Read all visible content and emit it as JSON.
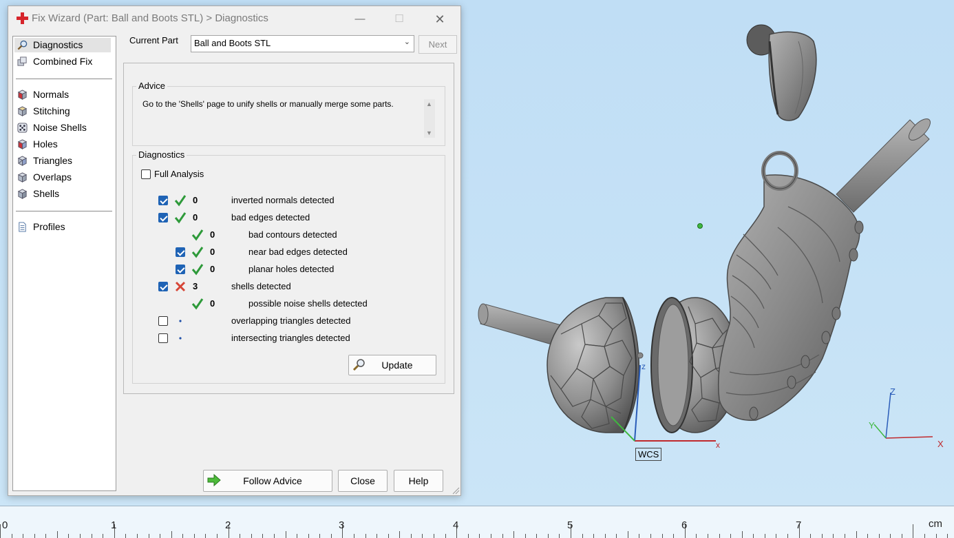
{
  "dialog": {
    "title": "Fix Wizard (Part: Ball and Boots STL) > Diagnostics",
    "window_controls": {
      "minimize": "—",
      "maximize": "☐",
      "close": "✕"
    }
  },
  "nav": {
    "items": [
      {
        "label": "Diagnostics",
        "icon": "magnifier-icon",
        "selected": true
      },
      {
        "label": "Combined Fix",
        "icon": "multi-cube-icon"
      },
      {
        "label": "Normals",
        "icon": "cube-red-face-icon"
      },
      {
        "label": "Stitching",
        "icon": "cube-stitch-icon"
      },
      {
        "label": "Noise Shells",
        "icon": "dice-icon"
      },
      {
        "label": "Holes",
        "icon": "cube-hole-icon"
      },
      {
        "label": "Triangles",
        "icon": "cube-triangle-icon"
      },
      {
        "label": "Overlaps",
        "icon": "cube-overlap-icon"
      },
      {
        "label": "Shells",
        "icon": "cube-shells-icon"
      },
      {
        "label": "Profiles",
        "icon": "document-icon"
      }
    ]
  },
  "header": {
    "current_part_label": "Current Part",
    "current_part_value": "Ball and Boots STL",
    "next_label": "Next"
  },
  "advice": {
    "title": "Advice",
    "text": "Go to the 'Shells' page to unify shells or manually merge some parts."
  },
  "diagnostics": {
    "title": "Diagnostics",
    "full_analysis_label": "Full Analysis",
    "full_analysis_checked": false,
    "rows": [
      {
        "checked": true,
        "status": "ok",
        "count": "0",
        "label": "inverted normals detected",
        "level": 0
      },
      {
        "checked": true,
        "status": "ok",
        "count": "0",
        "label": "bad edges detected",
        "level": 0
      },
      {
        "checked": null,
        "status": "ok",
        "count": "0",
        "label": "bad contours detected",
        "level": 1
      },
      {
        "checked": true,
        "status": "ok",
        "count": "0",
        "label": "near bad edges detected",
        "level": 1
      },
      {
        "checked": true,
        "status": "ok",
        "count": "0",
        "label": "planar holes detected",
        "level": 1
      },
      {
        "checked": true,
        "status": "error",
        "count": "3",
        "label": "shells detected",
        "level": 0
      },
      {
        "checked": null,
        "status": "ok",
        "count": "0",
        "label": "possible noise shells detected",
        "level": 1
      },
      {
        "checked": false,
        "status": "none",
        "count": "",
        "label": "overlapping triangles detected",
        "level": 0
      },
      {
        "checked": false,
        "status": "none",
        "count": "",
        "label": "intersecting triangles detected",
        "level": 0
      }
    ],
    "update_label": "Update"
  },
  "footer": {
    "follow_advice_label": "Follow Advice",
    "close_label": "Close",
    "help_label": "Help"
  },
  "viewport": {
    "wcs_label": "WCS",
    "axis_labels": {
      "x": "x",
      "z": "z",
      "X": "X",
      "Y": "Y",
      "Z": "Z"
    }
  },
  "ruler": {
    "labels": [
      "0",
      "1",
      "2",
      "3",
      "4",
      "5",
      "6",
      "7"
    ],
    "unit": "cm"
  },
  "colors": {
    "viewport_bg": "#c3e0f5",
    "check_accent": "#1f63b5",
    "ok_green": "#2e9a3a",
    "error_red": "#d64536",
    "model_gray": "#8e8e8e"
  }
}
